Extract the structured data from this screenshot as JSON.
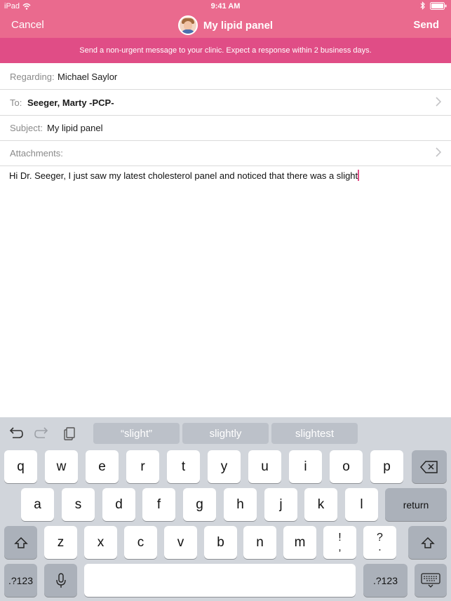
{
  "status": {
    "device": "iPad",
    "time": "9:41 AM"
  },
  "nav": {
    "cancel": "Cancel",
    "title": "My lipid panel",
    "send": "Send"
  },
  "banner": "Send a non-urgent message to your clinic. Expect a response within 2 business days.",
  "form": {
    "regarding_label": "Regarding:",
    "regarding_value": "Michael Saylor",
    "to_label": "To:",
    "to_value": "Seeger, Marty -PCP-",
    "subject_label": "Subject:",
    "subject_value": "My lipid panel",
    "attachments_label": "Attachments:"
  },
  "message_body": "Hi Dr. Seeger, I just saw my latest cholesterol panel and noticed that there was a slight",
  "keyboard": {
    "predictions": [
      "“slight”",
      "slightly",
      "slightest"
    ],
    "row1": [
      "q",
      "w",
      "e",
      "r",
      "t",
      "y",
      "u",
      "i",
      "o",
      "p"
    ],
    "row2": [
      "a",
      "s",
      "d",
      "f",
      "g",
      "h",
      "j",
      "k",
      "l"
    ],
    "return": "return",
    "row3": [
      "z",
      "x",
      "c",
      "v",
      "b",
      "n",
      "m"
    ],
    "punct1": [
      "!",
      ","
    ],
    "punct2": [
      "?",
      "."
    ],
    "numbers_left": ".?123",
    "numbers_right": ".?123"
  }
}
